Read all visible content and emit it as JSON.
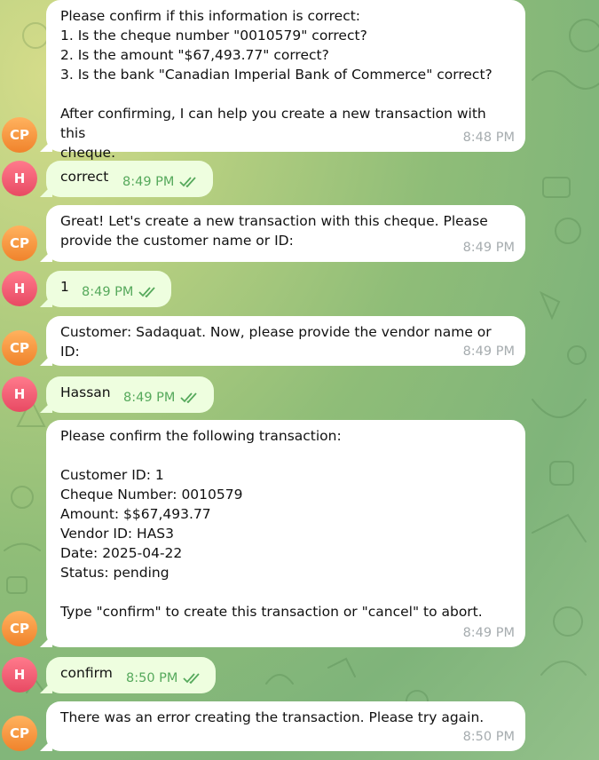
{
  "messages": [
    {
      "sender": "CP",
      "avatar": "CP",
      "text": "Please confirm if this information is correct:\n1. Is the cheque number \"0010579\" correct?\n2. Is the amount \"$67,493.77\" correct?\n3. Is the bank \"Canadian Imperial Bank of Commerce\" correct?\n\nAfter confirming, I can help you create a new transaction with this\ncheque.",
      "time": "8:48 PM"
    },
    {
      "sender": "H",
      "avatar": "H",
      "text": "correct",
      "time": "8:49 PM",
      "status": "read"
    },
    {
      "sender": "CP",
      "avatar": "CP",
      "text": "Great! Let's create a new transaction with this cheque. Please\nprovide the customer name or ID:",
      "time": "8:49 PM"
    },
    {
      "sender": "H",
      "avatar": "H",
      "text": "1",
      "time": "8:49 PM",
      "status": "read"
    },
    {
      "sender": "CP",
      "avatar": "CP",
      "text": "Customer: Sadaquat. Now, please provide the vendor name or ID:",
      "time": "8:49 PM"
    },
    {
      "sender": "H",
      "avatar": "H",
      "text": "Hassan",
      "time": "8:49 PM",
      "status": "read"
    },
    {
      "sender": "CP",
      "avatar": "CP",
      "text": "Please confirm the following transaction:\n\nCustomer ID: 1\nCheque Number: 0010579\nAmount: $$67,493.77\nVendor ID: HAS3\nDate: 2025-04-22\nStatus: pending\n\nType \"confirm\" to create this transaction or \"cancel\" to abort.",
      "time": "8:49 PM"
    },
    {
      "sender": "H",
      "avatar": "H",
      "text": "confirm",
      "time": "8:50 PM",
      "status": "read"
    },
    {
      "sender": "CP",
      "avatar": "CP",
      "text": "There was an error creating the transaction. Please try again.",
      "time": "8:50 PM"
    }
  ],
  "colors": {
    "incoming_bubble": "#ffffff",
    "outgoing_bubble": "#eefedf",
    "outgoing_time": "#56a95c",
    "incoming_time": "#a6acaf",
    "avatar_cp": "#f39a3f",
    "avatar_h": "#f0607a"
  },
  "icons": {
    "read_status": "double-check-icon"
  }
}
